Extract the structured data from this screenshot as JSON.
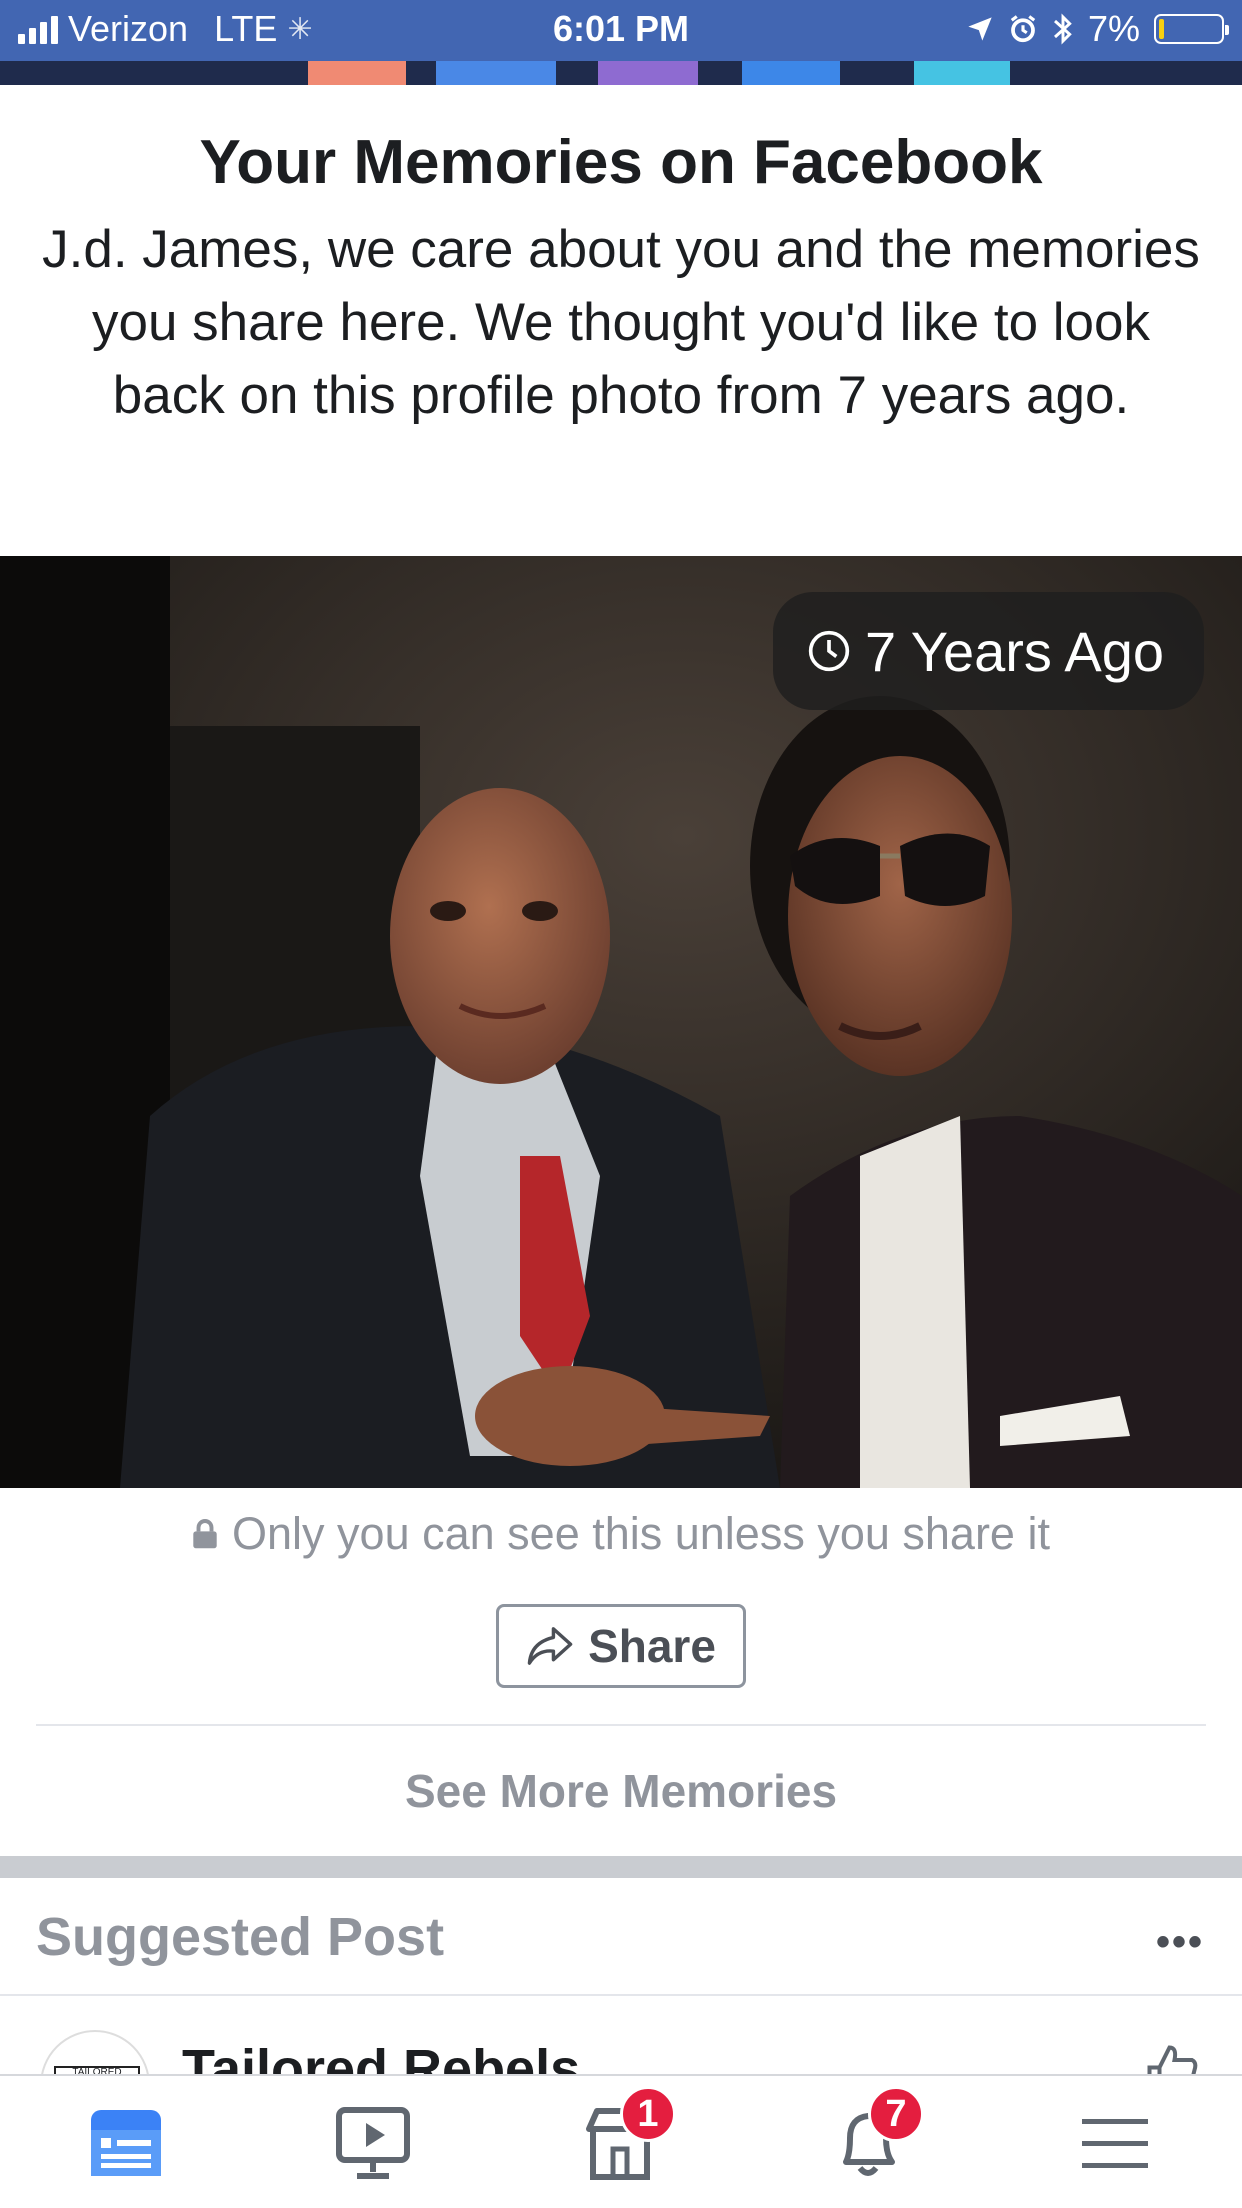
{
  "status_bar": {
    "carrier": "Verizon",
    "network": "LTE",
    "time": "6:01 PM",
    "battery": "7%",
    "battery_level": 0.07
  },
  "memory": {
    "title": "Your Memories on Facebook",
    "message": "J.d. James, we care about you and the memories you share here. We thought you'd like to look back on this profile photo from 7 years ago.",
    "badge": "7 Years Ago",
    "privacy_note": "Only you can see this unless you share it",
    "share_label": "Share",
    "see_more_label": "See More Memories"
  },
  "suggested": {
    "title": "Suggested Post",
    "more_label": "•••",
    "page_name": "Tailored Rebels",
    "avatar_text": "TAILORED REBELS"
  },
  "tab_bar": {
    "tabs": [
      {
        "name": "news-feed",
        "icon": "news-feed-icon",
        "badge": ""
      },
      {
        "name": "watch",
        "icon": "watch-video-icon",
        "badge": ""
      },
      {
        "name": "marketplace",
        "icon": "marketplace-icon",
        "badge": "1"
      },
      {
        "name": "notifications",
        "icon": "bell-icon",
        "badge": "7"
      },
      {
        "name": "menu",
        "icon": "hamburger-menu-icon",
        "badge": ""
      }
    ]
  },
  "colors": {
    "facebook_blue": "#4266b2",
    "active_tab": "#3b82f6",
    "badge_red": "#e41e3f",
    "muted_text": "#90949c"
  }
}
